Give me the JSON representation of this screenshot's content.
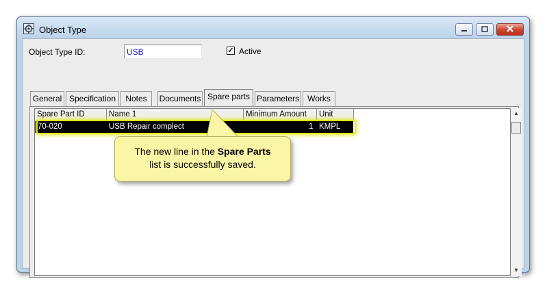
{
  "window": {
    "title": "Object Type",
    "minimize_icon": "minimize-icon",
    "maximize_icon": "maximize-icon",
    "close_icon": "close-icon"
  },
  "form": {
    "id_label": "Object Type ID:",
    "id_value": "USB",
    "active_label": "Active",
    "active_checked": true,
    "check_mark": "✓"
  },
  "tabs": [
    {
      "label": "General"
    },
    {
      "label": "Specification"
    },
    {
      "label": "Notes"
    },
    {
      "label": "Documents"
    },
    {
      "label": "Spare parts",
      "active": true
    },
    {
      "label": "Parameters"
    },
    {
      "label": "Works"
    }
  ],
  "grid": {
    "columns": [
      "Spare Part ID",
      "Name 1",
      "Minimum Amount",
      "Unit"
    ],
    "rows": [
      {
        "spare_part_id": "70-020",
        "name": "USB Repair complect",
        "minimum_amount": "1",
        "unit": "KMPL"
      }
    ]
  },
  "callout": {
    "line1_prefix": "The new line in the ",
    "line1_bold": "Spare Parts",
    "line2": "list is successfully saved."
  }
}
